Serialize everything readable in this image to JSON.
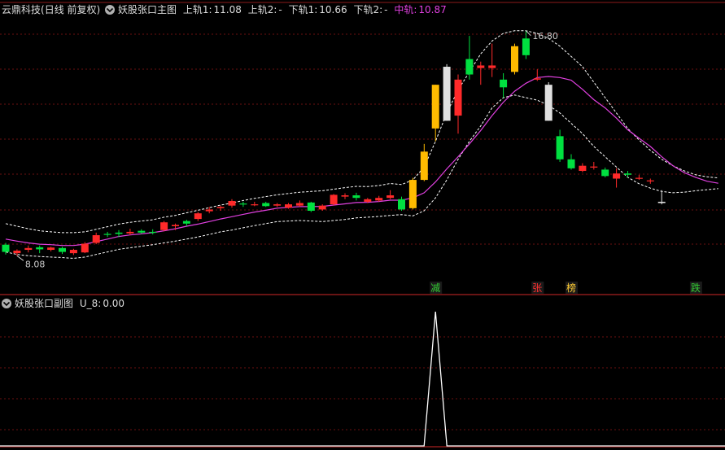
{
  "main_header": {
    "app_name": "云鼎科技",
    "period": "(日线 前复权)",
    "indicator_name": "妖股张口主图",
    "upper1_label": "上轨1:",
    "upper1_value": "11.08",
    "upper2_label": "上轨2:",
    "upper2_value": "-",
    "lower1_label": "下轨1:",
    "lower1_value": "10.66",
    "lower2_label": "下轨2:",
    "lower2_value": "-",
    "mid_label": "中轨:",
    "mid_value": "10.87"
  },
  "sub_header": {
    "indicator_name": "妖股张口副图",
    "u8_label": "U_8:",
    "u8_value": "0.00"
  },
  "price_annotations": {
    "high_label": "16.80",
    "low_label": "8.08"
  },
  "signals": [
    {
      "index": 38,
      "label": "减",
      "color": "#33cc33"
    },
    {
      "index": 47,
      "label": "张",
      "color": "#ff3030"
    },
    {
      "index": 50,
      "label": "榜",
      "color": "#ffcc33"
    },
    {
      "index": 61,
      "label": "跌",
      "color": "#33cc33"
    }
  ],
  "colors": {
    "up": "#ff2a2a",
    "down": "#00e040",
    "gold": "#ffbb00",
    "white": "#e0e0e0",
    "mid_line": "#e040e0",
    "band": "#ffffff",
    "grid": "#6b1010",
    "divider": "#8b1a1a",
    "header_text": "#dddddd",
    "mid_text": "#e040e0"
  },
  "chart_data": {
    "type": "candlestick",
    "price_range": [
      7.3,
      17.3
    ],
    "candles": [
      {
        "o": 8.2,
        "h": 8.55,
        "l": 8.1,
        "c": 8.48,
        "color": "down"
      },
      {
        "o": 8.25,
        "h": 8.3,
        "l": 8.05,
        "c": 8.15,
        "color": "up"
      },
      {
        "o": 8.35,
        "h": 8.45,
        "l": 8.18,
        "c": 8.28,
        "color": "up"
      },
      {
        "o": 8.3,
        "h": 8.45,
        "l": 8.15,
        "c": 8.38,
        "color": "down"
      },
      {
        "o": 8.37,
        "h": 8.4,
        "l": 8.22,
        "c": 8.28,
        "color": "up"
      },
      {
        "o": 8.2,
        "h": 8.4,
        "l": 8.12,
        "c": 8.35,
        "color": "down"
      },
      {
        "o": 8.28,
        "h": 8.32,
        "l": 8.08,
        "c": 8.15,
        "color": "up"
      },
      {
        "o": 8.18,
        "h": 8.58,
        "l": 8.15,
        "c": 8.52,
        "color": "up"
      },
      {
        "o": 8.55,
        "h": 8.95,
        "l": 8.5,
        "c": 8.85,
        "color": "up"
      },
      {
        "o": 8.88,
        "h": 8.98,
        "l": 8.78,
        "c": 8.9,
        "color": "down"
      },
      {
        "o": 8.9,
        "h": 9.05,
        "l": 8.78,
        "c": 8.95,
        "color": "down"
      },
      {
        "o": 8.92,
        "h": 9.1,
        "l": 8.85,
        "c": 8.98,
        "color": "up"
      },
      {
        "o": 8.95,
        "h": 9.08,
        "l": 8.9,
        "c": 9.02,
        "color": "down"
      },
      {
        "o": 8.95,
        "h": 9.08,
        "l": 8.88,
        "c": 8.98,
        "color": "down"
      },
      {
        "o": 9.05,
        "h": 9.4,
        "l": 9.0,
        "c": 9.35,
        "color": "up"
      },
      {
        "o": 9.2,
        "h": 9.3,
        "l": 9.05,
        "c": 9.25,
        "color": "up"
      },
      {
        "o": 9.3,
        "h": 9.45,
        "l": 9.2,
        "c": 9.4,
        "color": "down"
      },
      {
        "o": 9.48,
        "h": 9.75,
        "l": 9.4,
        "c": 9.7,
        "color": "up"
      },
      {
        "o": 9.78,
        "h": 9.95,
        "l": 9.7,
        "c": 9.85,
        "color": "up"
      },
      {
        "o": 9.9,
        "h": 10.0,
        "l": 9.8,
        "c": 9.95,
        "color": "up"
      },
      {
        "o": 10.0,
        "h": 10.25,
        "l": 9.92,
        "c": 10.18,
        "color": "up"
      },
      {
        "o": 10.05,
        "h": 10.15,
        "l": 9.95,
        "c": 10.08,
        "color": "down"
      },
      {
        "o": 10.05,
        "h": 10.15,
        "l": 9.98,
        "c": 10.05,
        "color": "up"
      },
      {
        "o": 10.1,
        "h": 10.15,
        "l": 9.95,
        "c": 9.98,
        "color": "down"
      },
      {
        "o": 10.05,
        "h": 10.1,
        "l": 9.95,
        "c": 10.0,
        "color": "up"
      },
      {
        "o": 9.92,
        "h": 10.1,
        "l": 9.88,
        "c": 10.05,
        "color": "up"
      },
      {
        "o": 10.1,
        "h": 10.2,
        "l": 9.95,
        "c": 10.0,
        "color": "up"
      },
      {
        "o": 10.12,
        "h": 10.15,
        "l": 9.75,
        "c": 9.8,
        "color": "down"
      },
      {
        "o": 9.85,
        "h": 10.05,
        "l": 9.8,
        "c": 10.0,
        "color": "up"
      },
      {
        "o": 10.05,
        "h": 10.45,
        "l": 10.0,
        "c": 10.42,
        "color": "up"
      },
      {
        "o": 10.35,
        "h": 10.48,
        "l": 10.25,
        "c": 10.4,
        "color": "up"
      },
      {
        "o": 10.4,
        "h": 10.5,
        "l": 10.2,
        "c": 10.3,
        "color": "down"
      },
      {
        "o": 10.25,
        "h": 10.3,
        "l": 10.1,
        "c": 10.15,
        "color": "up"
      },
      {
        "o": 10.2,
        "h": 10.38,
        "l": 10.15,
        "c": 10.3,
        "color": "up"
      },
      {
        "o": 10.3,
        "h": 10.6,
        "l": 10.25,
        "c": 10.4,
        "color": "up"
      },
      {
        "o": 10.25,
        "h": 10.35,
        "l": 9.8,
        "c": 9.85,
        "color": "down"
      },
      {
        "o": 9.9,
        "h": 11.08,
        "l": 9.85,
        "c": 11.0,
        "color": "gold"
      },
      {
        "o": 11.0,
        "h": 12.4,
        "l": 10.95,
        "c": 12.1,
        "color": "gold"
      },
      {
        "o": 13.0,
        "h": 14.7,
        "l": 12.5,
        "c": 14.7,
        "color": "gold"
      },
      {
        "o": 13.3,
        "h": 15.5,
        "l": 13.3,
        "c": 15.4,
        "color": "white"
      },
      {
        "o": 14.9,
        "h": 15.1,
        "l": 12.8,
        "c": 13.5,
        "color": "up"
      },
      {
        "o": 15.1,
        "h": 16.6,
        "l": 14.9,
        "c": 15.7,
        "color": "down"
      },
      {
        "o": 15.45,
        "h": 15.6,
        "l": 14.7,
        "c": 15.35,
        "color": "up"
      },
      {
        "o": 15.35,
        "h": 16.3,
        "l": 15.0,
        "c": 15.45,
        "color": "up"
      },
      {
        "o": 14.6,
        "h": 15.15,
        "l": 14.2,
        "c": 14.9,
        "color": "down"
      },
      {
        "o": 15.2,
        "h": 16.3,
        "l": 15.1,
        "c": 16.2,
        "color": "gold"
      },
      {
        "o": 15.85,
        "h": 16.8,
        "l": 15.7,
        "c": 16.5,
        "color": "down"
      },
      {
        "o": 14.95,
        "h": 15.3,
        "l": 14.85,
        "c": 14.9,
        "color": "up"
      },
      {
        "o": 14.7,
        "h": 14.8,
        "l": 13.3,
        "c": 13.3,
        "color": "white"
      },
      {
        "o": 12.7,
        "h": 12.95,
        "l": 11.7,
        "c": 11.8,
        "color": "down"
      },
      {
        "o": 11.8,
        "h": 12.0,
        "l": 11.4,
        "c": 11.45,
        "color": "down"
      },
      {
        "o": 11.55,
        "h": 11.65,
        "l": 11.3,
        "c": 11.35,
        "color": "up"
      },
      {
        "o": 11.48,
        "h": 11.7,
        "l": 11.4,
        "c": 11.52,
        "color": "up"
      },
      {
        "o": 11.4,
        "h": 11.48,
        "l": 11.1,
        "c": 11.15,
        "color": "down"
      },
      {
        "o": 11.25,
        "h": 11.45,
        "l": 10.7,
        "c": 11.05,
        "color": "up"
      },
      {
        "o": 11.2,
        "h": 11.35,
        "l": 11.1,
        "c": 11.25,
        "color": "down"
      },
      {
        "o": 11.08,
        "h": 11.2,
        "l": 11.0,
        "c": 11.05,
        "color": "up"
      },
      {
        "o": 10.98,
        "h": 11.05,
        "l": 10.85,
        "c": 10.95,
        "color": "up"
      },
      {
        "o": 10.15,
        "h": 10.6,
        "l": 10.05,
        "c": 10.1,
        "color": "white"
      }
    ],
    "mid_line": [
      8.7,
      8.62,
      8.55,
      8.5,
      8.48,
      8.45,
      8.45,
      8.5,
      8.6,
      8.7,
      8.8,
      8.86,
      8.9,
      8.95,
      9.02,
      9.1,
      9.2,
      9.28,
      9.38,
      9.48,
      9.57,
      9.66,
      9.75,
      9.82,
      9.9,
      9.93,
      9.96,
      9.96,
      9.97,
      10.02,
      10.07,
      10.12,
      10.13,
      10.16,
      10.21,
      10.21,
      10.3,
      10.5,
      10.92,
      11.43,
      11.9,
      12.4,
      12.92,
      13.5,
      14.02,
      14.45,
      14.76,
      14.98,
      15.02,
      14.98,
      14.88,
      14.52,
      14.12,
      13.8,
      13.4,
      12.95,
      12.62,
      12.3,
      11.9,
      11.55,
      11.28,
      11.1,
      10.95,
      10.87
    ],
    "upper_band": [
      9.3,
      9.2,
      9.1,
      9.02,
      8.98,
      8.95,
      8.95,
      8.98,
      9.08,
      9.18,
      9.28,
      9.35,
      9.4,
      9.45,
      9.55,
      9.62,
      9.72,
      9.82,
      9.92,
      10.02,
      10.1,
      10.2,
      10.28,
      10.35,
      10.42,
      10.47,
      10.52,
      10.55,
      10.58,
      10.64,
      10.7,
      10.75,
      10.74,
      10.78,
      10.86,
      10.82,
      11.0,
      11.5,
      12.5,
      13.6,
      14.5,
      15.2,
      15.9,
      16.4,
      16.7,
      16.8,
      16.8,
      16.7,
      16.5,
      16.2,
      15.8,
      15.4,
      14.8,
      14.2,
      13.6,
      13.0,
      12.55,
      12.15,
      11.8,
      11.55,
      11.35,
      11.2,
      11.12,
      11.08
    ],
    "lower_band": [
      8.2,
      8.1,
      8.05,
      8.02,
      8.0,
      7.98,
      7.95,
      8.0,
      8.1,
      8.2,
      8.3,
      8.36,
      8.42,
      8.48,
      8.55,
      8.62,
      8.7,
      8.78,
      8.88,
      8.98,
      9.05,
      9.14,
      9.22,
      9.3,
      9.38,
      9.4,
      9.42,
      9.4,
      9.38,
      9.42,
      9.46,
      9.52,
      9.55,
      9.58,
      9.62,
      9.65,
      9.6,
      9.8,
      10.3,
      11.0,
      11.8,
      12.5,
      13.1,
      13.8,
      14.2,
      14.3,
      14.2,
      14.1,
      13.9,
      13.6,
      13.2,
      12.8,
      12.3,
      11.9,
      11.5,
      11.1,
      10.85,
      10.68,
      10.55,
      10.5,
      10.52,
      10.58,
      10.62,
      10.66
    ],
    "sub_series": {
      "name": "U_8",
      "spike_index": 38,
      "spike_value": 1,
      "range": [
        0,
        1
      ]
    }
  }
}
